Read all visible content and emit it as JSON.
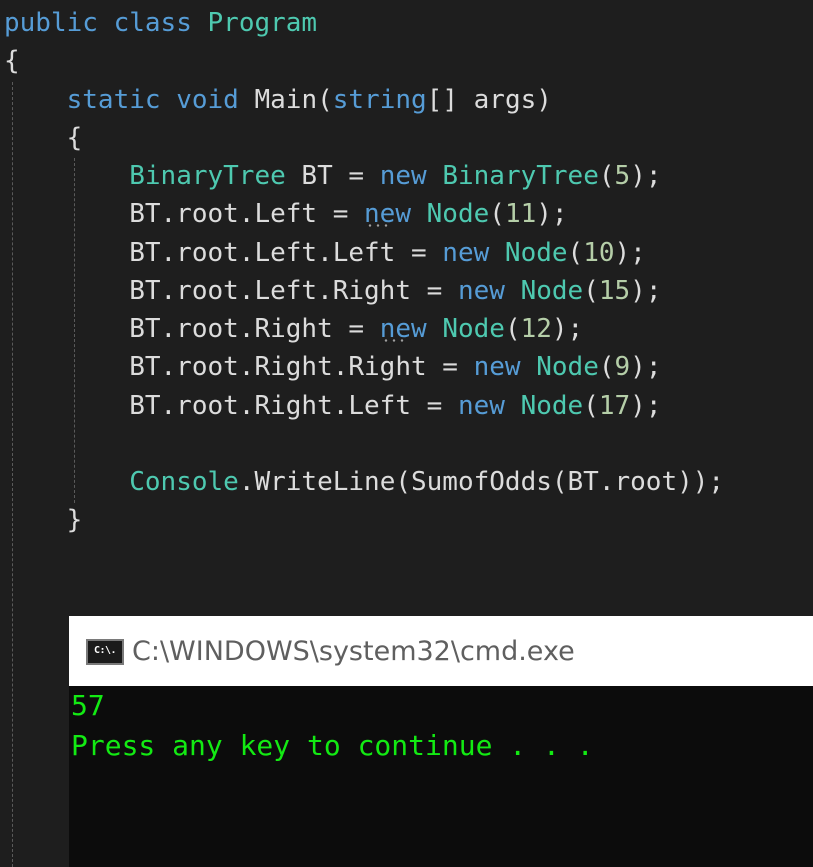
{
  "code": {
    "lines": [
      {
        "parts": [
          {
            "t": "public",
            "c": "kw"
          },
          {
            "t": " "
          },
          {
            "t": "class",
            "c": "kw"
          },
          {
            "t": " "
          },
          {
            "t": "Program",
            "c": "ty"
          }
        ]
      },
      {
        "parts": [
          {
            "t": "{"
          }
        ]
      },
      {
        "parts": [
          {
            "t": "    "
          },
          {
            "t": "static",
            "c": "kw"
          },
          {
            "t": " "
          },
          {
            "t": "void",
            "c": "kw"
          },
          {
            "t": " Main("
          },
          {
            "t": "string",
            "c": "kw"
          },
          {
            "t": "[] args)"
          }
        ]
      },
      {
        "parts": [
          {
            "t": "    {"
          }
        ]
      },
      {
        "parts": [
          {
            "t": "        "
          },
          {
            "t": "BinaryTree",
            "c": "ty"
          },
          {
            "t": " BT = "
          },
          {
            "t": "new",
            "c": "kw"
          },
          {
            "t": " "
          },
          {
            "t": "BinaryTree",
            "c": "ty"
          },
          {
            "t": "("
          },
          {
            "t": "5",
            "c": "num"
          },
          {
            "t": ");"
          }
        ]
      },
      {
        "parts": [
          {
            "t": "        BT.root.Left = "
          },
          {
            "t": "new",
            "c": "kw",
            "squiggle": true
          },
          {
            "t": " "
          },
          {
            "t": "Node",
            "c": "ty"
          },
          {
            "t": "("
          },
          {
            "t": "11",
            "c": "num"
          },
          {
            "t": ");"
          }
        ]
      },
      {
        "parts": [
          {
            "t": "        BT.root.Left.Left = "
          },
          {
            "t": "new",
            "c": "kw"
          },
          {
            "t": " "
          },
          {
            "t": "Node",
            "c": "ty"
          },
          {
            "t": "("
          },
          {
            "t": "10",
            "c": "num"
          },
          {
            "t": ");"
          }
        ]
      },
      {
        "parts": [
          {
            "t": "        BT.root.Left.Right = "
          },
          {
            "t": "new",
            "c": "kw"
          },
          {
            "t": " "
          },
          {
            "t": "Node",
            "c": "ty"
          },
          {
            "t": "("
          },
          {
            "t": "15",
            "c": "num"
          },
          {
            "t": ");"
          }
        ]
      },
      {
        "parts": [
          {
            "t": "        BT.root.Right = "
          },
          {
            "t": "new",
            "c": "kw",
            "squiggle": true
          },
          {
            "t": " "
          },
          {
            "t": "Node",
            "c": "ty"
          },
          {
            "t": "("
          },
          {
            "t": "12",
            "c": "num"
          },
          {
            "t": ");"
          }
        ]
      },
      {
        "parts": [
          {
            "t": "        BT.root.Right.Right = "
          },
          {
            "t": "new",
            "c": "kw"
          },
          {
            "t": " "
          },
          {
            "t": "Node",
            "c": "ty"
          },
          {
            "t": "("
          },
          {
            "t": "9",
            "c": "num"
          },
          {
            "t": ");"
          }
        ]
      },
      {
        "parts": [
          {
            "t": "        BT.root.Right.Left = "
          },
          {
            "t": "new",
            "c": "kw"
          },
          {
            "t": " "
          },
          {
            "t": "Node",
            "c": "ty"
          },
          {
            "t": "("
          },
          {
            "t": "17",
            "c": "num"
          },
          {
            "t": ");"
          }
        ]
      },
      {
        "parts": [
          {
            "t": ""
          }
        ]
      },
      {
        "parts": [
          {
            "t": "        "
          },
          {
            "t": "Console",
            "c": "ty"
          },
          {
            "t": ".WriteLine(SumofOdds(BT.root));"
          }
        ]
      },
      {
        "parts": [
          {
            "t": "    }"
          }
        ]
      }
    ]
  },
  "console": {
    "icon_label": "C:\\.",
    "title": "C:\\WINDOWS\\system32\\cmd.exe",
    "output": [
      "57",
      "Press any key to continue . . ."
    ]
  },
  "colors": {
    "editor_background": "#1e1e1e",
    "keyword": "#569cd6",
    "type": "#4ec9b0",
    "number": "#b5cea8",
    "text": "#dcdcdc",
    "console_text": "#13ea13",
    "console_background": "#0c0c0c"
  },
  "icons": {
    "console_icon": "cmd-icon"
  }
}
